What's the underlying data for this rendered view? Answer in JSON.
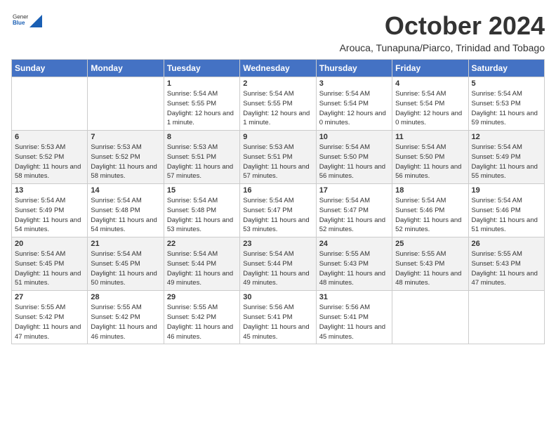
{
  "logo": {
    "general": "General",
    "blue": "Blue"
  },
  "header": {
    "month": "October 2024",
    "subtitle": "Arouca, Tunapuna/Piarco, Trinidad and Tobago"
  },
  "weekdays": [
    "Sunday",
    "Monday",
    "Tuesday",
    "Wednesday",
    "Thursday",
    "Friday",
    "Saturday"
  ],
  "weeks": [
    [
      {
        "day": null
      },
      {
        "day": null
      },
      {
        "day": 1,
        "sunrise": "5:54 AM",
        "sunset": "5:55 PM",
        "daylight": "12 hours and 1 minute."
      },
      {
        "day": 2,
        "sunrise": "5:54 AM",
        "sunset": "5:55 PM",
        "daylight": "12 hours and 1 minute."
      },
      {
        "day": 3,
        "sunrise": "5:54 AM",
        "sunset": "5:54 PM",
        "daylight": "12 hours and 0 minutes."
      },
      {
        "day": 4,
        "sunrise": "5:54 AM",
        "sunset": "5:54 PM",
        "daylight": "12 hours and 0 minutes."
      },
      {
        "day": 5,
        "sunrise": "5:54 AM",
        "sunset": "5:53 PM",
        "daylight": "11 hours and 59 minutes."
      }
    ],
    [
      {
        "day": 6,
        "sunrise": "5:53 AM",
        "sunset": "5:52 PM",
        "daylight": "11 hours and 58 minutes."
      },
      {
        "day": 7,
        "sunrise": "5:53 AM",
        "sunset": "5:52 PM",
        "daylight": "11 hours and 58 minutes."
      },
      {
        "day": 8,
        "sunrise": "5:53 AM",
        "sunset": "5:51 PM",
        "daylight": "11 hours and 57 minutes."
      },
      {
        "day": 9,
        "sunrise": "5:53 AM",
        "sunset": "5:51 PM",
        "daylight": "11 hours and 57 minutes."
      },
      {
        "day": 10,
        "sunrise": "5:54 AM",
        "sunset": "5:50 PM",
        "daylight": "11 hours and 56 minutes."
      },
      {
        "day": 11,
        "sunrise": "5:54 AM",
        "sunset": "5:50 PM",
        "daylight": "11 hours and 56 minutes."
      },
      {
        "day": 12,
        "sunrise": "5:54 AM",
        "sunset": "5:49 PM",
        "daylight": "11 hours and 55 minutes."
      }
    ],
    [
      {
        "day": 13,
        "sunrise": "5:54 AM",
        "sunset": "5:49 PM",
        "daylight": "11 hours and 54 minutes."
      },
      {
        "day": 14,
        "sunrise": "5:54 AM",
        "sunset": "5:48 PM",
        "daylight": "11 hours and 54 minutes."
      },
      {
        "day": 15,
        "sunrise": "5:54 AM",
        "sunset": "5:48 PM",
        "daylight": "11 hours and 53 minutes."
      },
      {
        "day": 16,
        "sunrise": "5:54 AM",
        "sunset": "5:47 PM",
        "daylight": "11 hours and 53 minutes."
      },
      {
        "day": 17,
        "sunrise": "5:54 AM",
        "sunset": "5:47 PM",
        "daylight": "11 hours and 52 minutes."
      },
      {
        "day": 18,
        "sunrise": "5:54 AM",
        "sunset": "5:46 PM",
        "daylight": "11 hours and 52 minutes."
      },
      {
        "day": 19,
        "sunrise": "5:54 AM",
        "sunset": "5:46 PM",
        "daylight": "11 hours and 51 minutes."
      }
    ],
    [
      {
        "day": 20,
        "sunrise": "5:54 AM",
        "sunset": "5:45 PM",
        "daylight": "11 hours and 51 minutes."
      },
      {
        "day": 21,
        "sunrise": "5:54 AM",
        "sunset": "5:45 PM",
        "daylight": "11 hours and 50 minutes."
      },
      {
        "day": 22,
        "sunrise": "5:54 AM",
        "sunset": "5:44 PM",
        "daylight": "11 hours and 49 minutes."
      },
      {
        "day": 23,
        "sunrise": "5:54 AM",
        "sunset": "5:44 PM",
        "daylight": "11 hours and 49 minutes."
      },
      {
        "day": 24,
        "sunrise": "5:55 AM",
        "sunset": "5:43 PM",
        "daylight": "11 hours and 48 minutes."
      },
      {
        "day": 25,
        "sunrise": "5:55 AM",
        "sunset": "5:43 PM",
        "daylight": "11 hours and 48 minutes."
      },
      {
        "day": 26,
        "sunrise": "5:55 AM",
        "sunset": "5:43 PM",
        "daylight": "11 hours and 47 minutes."
      }
    ],
    [
      {
        "day": 27,
        "sunrise": "5:55 AM",
        "sunset": "5:42 PM",
        "daylight": "11 hours and 47 minutes."
      },
      {
        "day": 28,
        "sunrise": "5:55 AM",
        "sunset": "5:42 PM",
        "daylight": "11 hours and 46 minutes."
      },
      {
        "day": 29,
        "sunrise": "5:55 AM",
        "sunset": "5:42 PM",
        "daylight": "11 hours and 46 minutes."
      },
      {
        "day": 30,
        "sunrise": "5:56 AM",
        "sunset": "5:41 PM",
        "daylight": "11 hours and 45 minutes."
      },
      {
        "day": 31,
        "sunrise": "5:56 AM",
        "sunset": "5:41 PM",
        "daylight": "11 hours and 45 minutes."
      },
      {
        "day": null
      },
      {
        "day": null
      }
    ]
  ],
  "labels": {
    "sunrise": "Sunrise:",
    "sunset": "Sunset:",
    "daylight": "Daylight:"
  }
}
